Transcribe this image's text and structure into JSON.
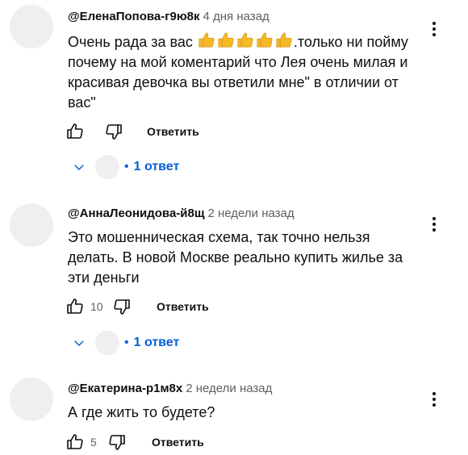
{
  "colors": {
    "text": "#0f0f0f",
    "meta": "#606060",
    "link": "#065fd4",
    "avatar_placeholder": "#efefef"
  },
  "comments": [
    {
      "author": "@ЕленаПопова-г9ю8к",
      "time": "4 дня назад",
      "text_before_emoji": "Очень рада за вас ",
      "emoji": [
        "thumbs-up",
        "thumbs-up",
        "thumbs-up",
        "thumbs-up",
        "thumbs-up"
      ],
      "text_after_emoji": ".только ни пойму почему на мой коментарий что Лея очень милая и красивая девочка вы ответили мне\" в отличии от вас\"",
      "likes": "",
      "reply_label": "Ответить",
      "replies_label": "1 ответ",
      "replies_separator": "•"
    },
    {
      "author": "@АннаЛеонидова-й8щ",
      "time": "2 недели назад",
      "text": "Это мошенническая схема, так точно нельзя делать. В новой Москве реально купить  жилье  за эти деньги",
      "likes": "10",
      "reply_label": "Ответить",
      "replies_label": "1 ответ",
      "replies_separator": "•"
    },
    {
      "author": "@Екатерина-р1м8х",
      "time": "2 недели назад",
      "text": "А где жить то будете?",
      "likes": "5",
      "reply_label": "Ответить"
    }
  ]
}
